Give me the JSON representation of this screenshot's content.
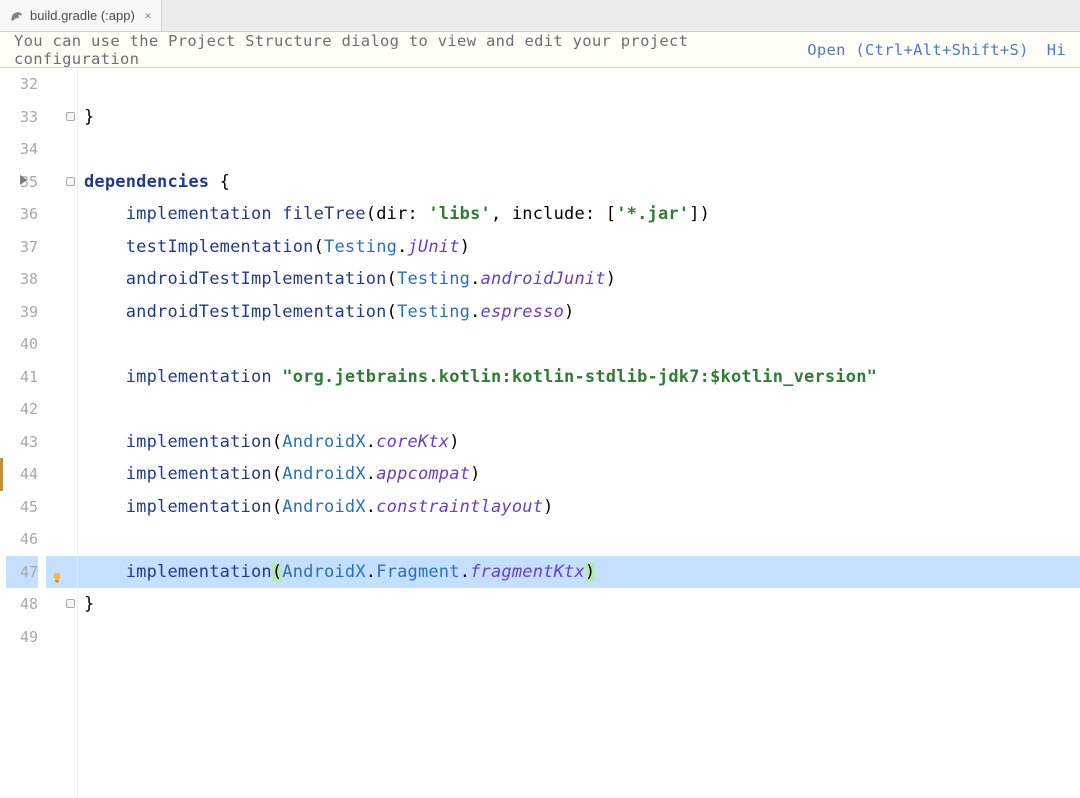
{
  "tab": {
    "label": "build.gradle (:app)"
  },
  "notification": {
    "text": "You can use the Project Structure dialog to view and edit your project configuration",
    "open_label": "Open (Ctrl+Alt+Shift+S)",
    "hide_label": "Hi"
  },
  "editor": {
    "highlighted_line": 47,
    "edit_marks": [
      44
    ],
    "lines": [
      {
        "num": 32,
        "tokens": []
      },
      {
        "num": 33,
        "fold": "close",
        "tokens": [
          {
            "t": "}",
            "c": ""
          }
        ]
      },
      {
        "num": 34,
        "tokens": []
      },
      {
        "num": 35,
        "fold": "open",
        "arrow": true,
        "tokens": [
          {
            "t": "dependencies",
            "c": "kw"
          },
          {
            "t": " {",
            "c": ""
          }
        ]
      },
      {
        "num": 36,
        "tokens": [
          {
            "t": "    ",
            "c": ""
          },
          {
            "t": "implementation",
            "c": "fn"
          },
          {
            "t": " ",
            "c": ""
          },
          {
            "t": "fileTree",
            "c": "fn"
          },
          {
            "t": "(dir: ",
            "c": ""
          },
          {
            "t": "'libs'",
            "c": "str"
          },
          {
            "t": ", include: [",
            "c": ""
          },
          {
            "t": "'*.jar'",
            "c": "str"
          },
          {
            "t": "])",
            "c": ""
          }
        ]
      },
      {
        "num": 37,
        "tokens": [
          {
            "t": "    ",
            "c": ""
          },
          {
            "t": "testImplementation",
            "c": "fn"
          },
          {
            "t": "(",
            "c": ""
          },
          {
            "t": "Testing",
            "c": "cls"
          },
          {
            "t": ".",
            "c": ""
          },
          {
            "t": "jUnit",
            "c": "prop"
          },
          {
            "t": ")",
            "c": ""
          }
        ]
      },
      {
        "num": 38,
        "tokens": [
          {
            "t": "    ",
            "c": ""
          },
          {
            "t": "androidTestImplementation",
            "c": "fn"
          },
          {
            "t": "(",
            "c": ""
          },
          {
            "t": "Testing",
            "c": "cls"
          },
          {
            "t": ".",
            "c": ""
          },
          {
            "t": "androidJunit",
            "c": "prop"
          },
          {
            "t": ")",
            "c": ""
          }
        ]
      },
      {
        "num": 39,
        "tokens": [
          {
            "t": "    ",
            "c": ""
          },
          {
            "t": "androidTestImplementation",
            "c": "fn"
          },
          {
            "t": "(",
            "c": ""
          },
          {
            "t": "Testing",
            "c": "cls"
          },
          {
            "t": ".",
            "c": ""
          },
          {
            "t": "espresso",
            "c": "prop"
          },
          {
            "t": ")",
            "c": ""
          }
        ]
      },
      {
        "num": 40,
        "tokens": []
      },
      {
        "num": 41,
        "tokens": [
          {
            "t": "    ",
            "c": ""
          },
          {
            "t": "implementation",
            "c": "fn"
          },
          {
            "t": " ",
            "c": ""
          },
          {
            "t": "\"org.jetbrains.kotlin:kotlin-stdlib-jdk7:$kotlin_version\"",
            "c": "str"
          }
        ]
      },
      {
        "num": 42,
        "tokens": []
      },
      {
        "num": 43,
        "tokens": [
          {
            "t": "    ",
            "c": ""
          },
          {
            "t": "implementation",
            "c": "fn"
          },
          {
            "t": "(",
            "c": ""
          },
          {
            "t": "AndroidX",
            "c": "cls"
          },
          {
            "t": ".",
            "c": ""
          },
          {
            "t": "coreKtx",
            "c": "prop"
          },
          {
            "t": ")",
            "c": ""
          }
        ]
      },
      {
        "num": 44,
        "tokens": [
          {
            "t": "    ",
            "c": ""
          },
          {
            "t": "implementation",
            "c": "fn"
          },
          {
            "t": "(",
            "c": ""
          },
          {
            "t": "AndroidX",
            "c": "cls"
          },
          {
            "t": ".",
            "c": ""
          },
          {
            "t": "appcompat",
            "c": "prop"
          },
          {
            "t": ")",
            "c": ""
          }
        ]
      },
      {
        "num": 45,
        "tokens": [
          {
            "t": "    ",
            "c": ""
          },
          {
            "t": "implementation",
            "c": "fn"
          },
          {
            "t": "(",
            "c": ""
          },
          {
            "t": "AndroidX",
            "c": "cls"
          },
          {
            "t": ".",
            "c": ""
          },
          {
            "t": "constraintlayout",
            "c": "prop"
          },
          {
            "t": ")",
            "c": ""
          }
        ]
      },
      {
        "num": 46,
        "tokens": []
      },
      {
        "num": 47,
        "bulb": true,
        "tokens": [
          {
            "t": "    ",
            "c": ""
          },
          {
            "t": "implementation",
            "c": "fn"
          },
          {
            "t": "(",
            "c": "paren-match"
          },
          {
            "t": "AndroidX",
            "c": "cls"
          },
          {
            "t": ".",
            "c": ""
          },
          {
            "t": "Fragment",
            "c": "cls"
          },
          {
            "t": ".",
            "c": ""
          },
          {
            "t": "fragmentKtx",
            "c": "prop"
          },
          {
            "t": ")",
            "c": "paren-match"
          }
        ]
      },
      {
        "num": 48,
        "fold": "close",
        "tokens": [
          {
            "t": "}",
            "c": ""
          }
        ]
      },
      {
        "num": 49,
        "tokens": []
      }
    ]
  }
}
